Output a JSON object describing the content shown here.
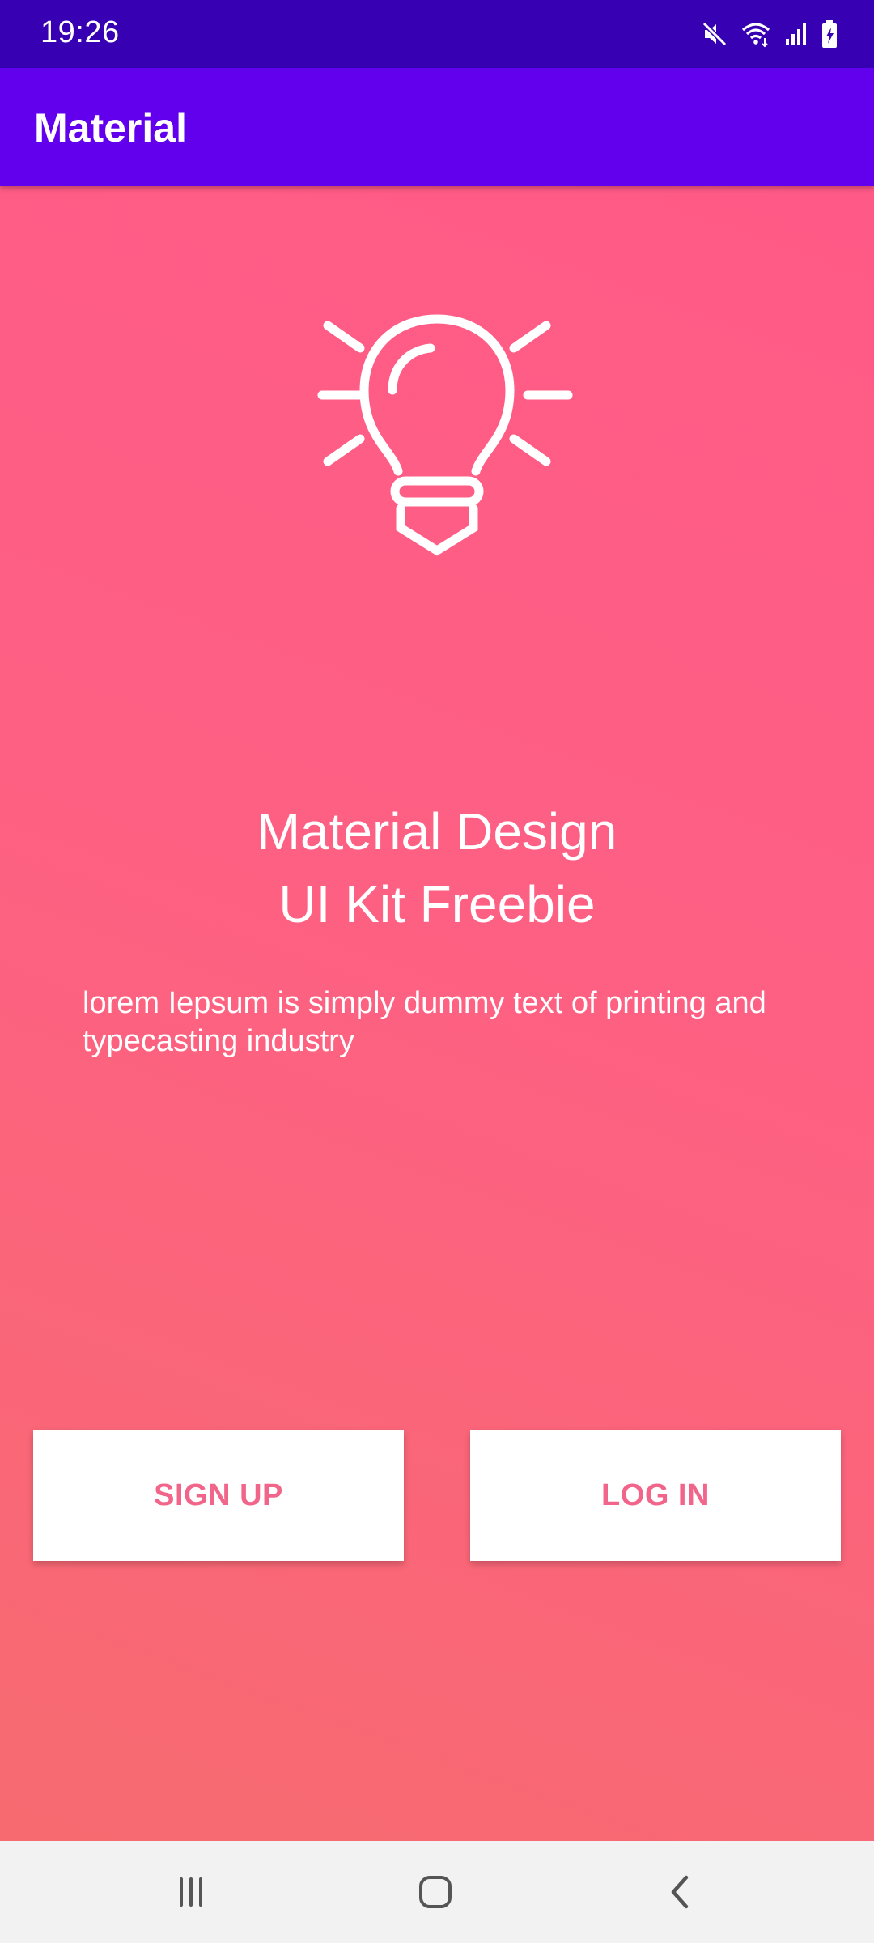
{
  "status_bar": {
    "time": "19:26",
    "icons": [
      "mute-icon",
      "wifi-icon",
      "signal-icon",
      "battery-charging-icon"
    ]
  },
  "app_bar": {
    "title": "Material"
  },
  "hero": {
    "icon": "lightbulb-icon",
    "headline_line1": "Material Design",
    "headline_line2": "UI Kit Freebie",
    "body": "lorem Iepsum is simply dummy text of printing and typecasting industry"
  },
  "buttons": {
    "signup_label": "SIGN UP",
    "login_label": "LOG IN"
  },
  "nav_bar": {
    "icons": [
      "recents-icon",
      "home-icon",
      "back-icon"
    ]
  },
  "colors": {
    "status_bar": "#3700B3",
    "app_bar": "#6200EE",
    "gradient_top": "#FF5A87",
    "gradient_bottom": "#F76B70",
    "button_text": "#F2658A"
  }
}
